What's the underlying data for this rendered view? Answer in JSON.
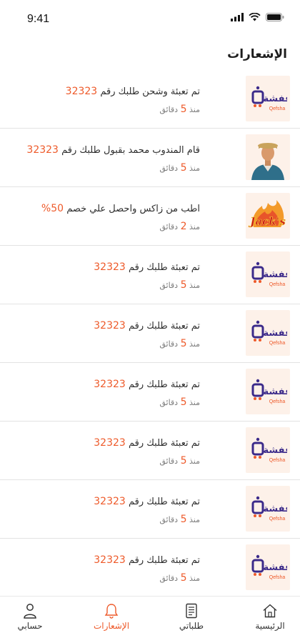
{
  "status": {
    "time": "9:41"
  },
  "header": {
    "title": "الإشعارات"
  },
  "notifications": [
    {
      "logo": "qefsha-logo",
      "text": "تم تعبئة وشحن طلبك رقم",
      "highlight": "32323",
      "time_prefix": "منذ",
      "time_num": "5",
      "time_unit": "دقائق"
    },
    {
      "logo": "delegate-photo",
      "text": "قام المندوب محمد بقبول طلبك رقم",
      "highlight": "32323",
      "time_prefix": "منذ",
      "time_num": "5",
      "time_unit": "دقائق"
    },
    {
      "logo": "jacks-logo",
      "text": "اطب من زاكس واحصل علي خصم",
      "highlight": "50%",
      "time_prefix": "منذ",
      "time_num": "2",
      "time_unit": "دقائق"
    },
    {
      "logo": "qefsha-logo",
      "text": "تم تعبئة طلبك رقم",
      "highlight": "32323",
      "time_prefix": "منذ",
      "time_num": "5",
      "time_unit": "دقائق"
    },
    {
      "logo": "qefsha-logo",
      "text": "تم تعبئة طلبك رقم",
      "highlight": "32323",
      "time_prefix": "منذ",
      "time_num": "5",
      "time_unit": "دقائق"
    },
    {
      "logo": "qefsha-logo",
      "text": "تم تعبئة طلبك رقم",
      "highlight": "32323",
      "time_prefix": "منذ",
      "time_num": "5",
      "time_unit": "دقائق"
    },
    {
      "logo": "qefsha-logo",
      "text": "تم تعبئة طلبك رقم",
      "highlight": "32323",
      "time_prefix": "منذ",
      "time_num": "5",
      "time_unit": "دقائق"
    },
    {
      "logo": "qefsha-logo",
      "text": "تم تعبئة طلبك رقم",
      "highlight": "32323",
      "time_prefix": "منذ",
      "time_num": "5",
      "time_unit": "دقائق"
    },
    {
      "logo": "qefsha-logo",
      "text": "تم تعبئة طلبك رقم",
      "highlight": "32323",
      "time_prefix": "منذ",
      "time_num": "5",
      "time_unit": "دقائق"
    }
  ],
  "brand": {
    "qefsha_name": "قفشة",
    "qefsha_latin": "Qefsha",
    "jacks_name": "Jack's"
  },
  "nav": {
    "items": [
      {
        "label": "الرئيسية",
        "icon": "home-icon"
      },
      {
        "label": "طلباتي",
        "icon": "orders-icon"
      },
      {
        "label": "الإشعارات",
        "icon": "bell-icon",
        "active": true
      },
      {
        "label": "حسابي",
        "icon": "user-icon"
      }
    ]
  },
  "colors": {
    "accent": "#ee5a2a",
    "brand_purple": "#3b2a8a",
    "thumb_bg": "#fdf1e9"
  }
}
